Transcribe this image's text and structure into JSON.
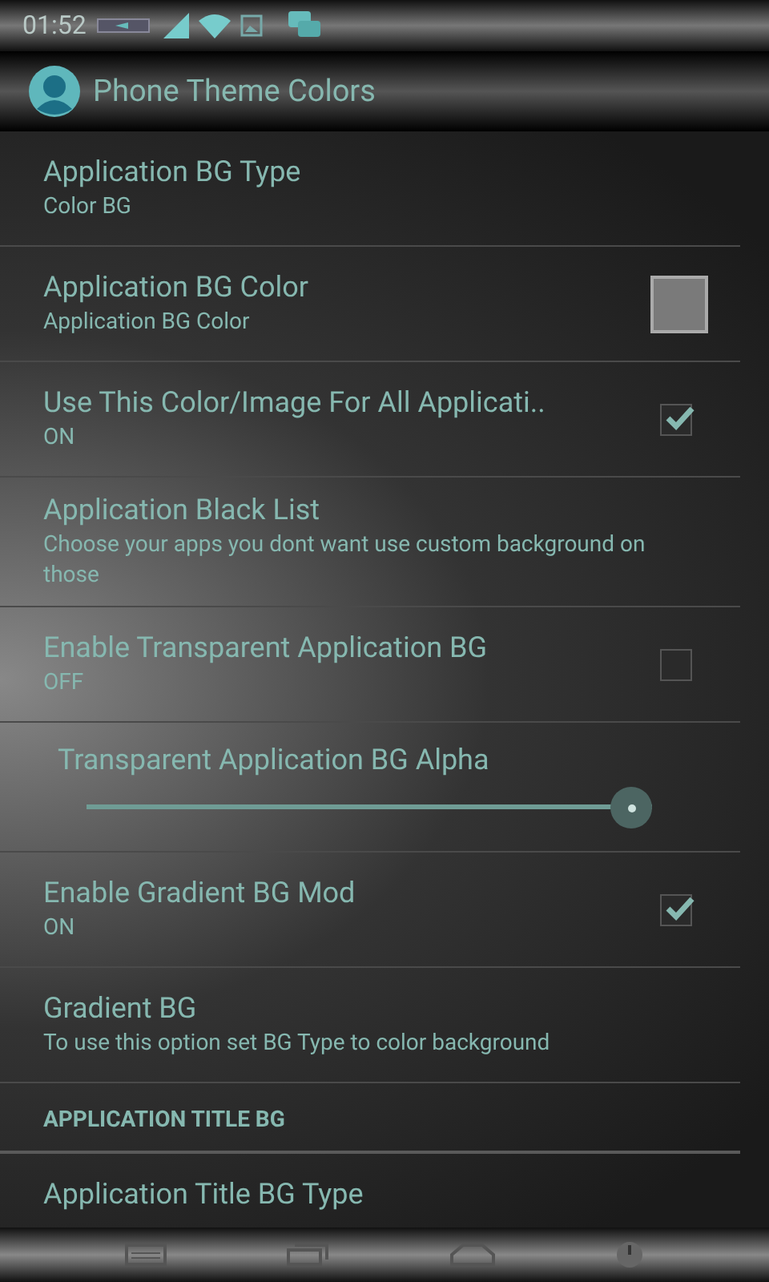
{
  "status_bar": {
    "time": "01:52"
  },
  "action_bar": {
    "title": "Phone Theme Colors"
  },
  "items": [
    {
      "kind": "text",
      "title": "Application BG Type",
      "summary": "Color BG"
    },
    {
      "kind": "color",
      "title": "Application BG Color",
      "summary": "Application BG Color",
      "color": "#7a7a7a"
    },
    {
      "kind": "checkbox",
      "title": "Use This Color/Image For All Applicati..",
      "summary": "ON",
      "checked": true
    },
    {
      "kind": "text",
      "title": "Application Black List",
      "summary": "Choose your apps you dont want use custom background on those"
    },
    {
      "kind": "checkbox",
      "title": "Enable Transparent Application BG",
      "summary": "OFF",
      "checked": false
    },
    {
      "kind": "slider",
      "title": "Transparent Application BG Alpha",
      "level": 1.0
    },
    {
      "kind": "checkbox",
      "title": "Enable Gradient BG Mod",
      "summary": "ON",
      "checked": true
    },
    {
      "kind": "text",
      "title": "Gradient BG",
      "summary": "To use this option set BG Type to color background"
    },
    {
      "kind": "header",
      "title": "APPLICATION TITLE BG"
    },
    {
      "kind": "text",
      "title": "Application Title BG Type"
    }
  ]
}
